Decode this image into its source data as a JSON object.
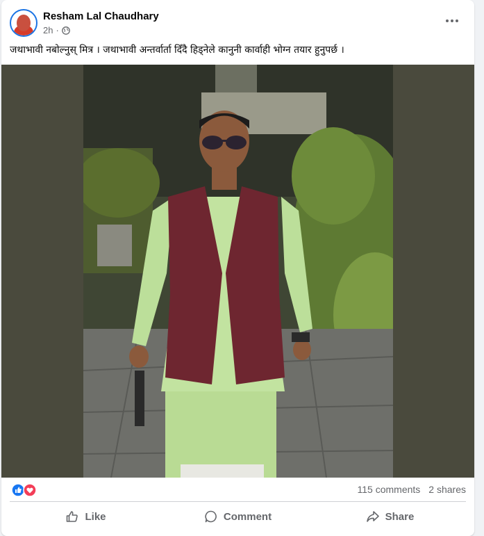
{
  "post": {
    "author": "Resham Lal Chaudhary",
    "time": "2h",
    "caption": "जथाभावी नबोल्नुस् मित्र । जथाभावी अन्तर्वार्ता दिँदै हिड्नेले कानुनी कार्वाही भोग्न तयार हुनुपर्छ ।"
  },
  "stats": {
    "comments": "115 comments",
    "shares": "2 shares"
  },
  "actions": {
    "like": "Like",
    "comment": "Comment",
    "share": "Share"
  },
  "colors": {
    "like_blue": "#1877f2",
    "love_red": "#f33e58",
    "muted_text": "#65676b"
  }
}
